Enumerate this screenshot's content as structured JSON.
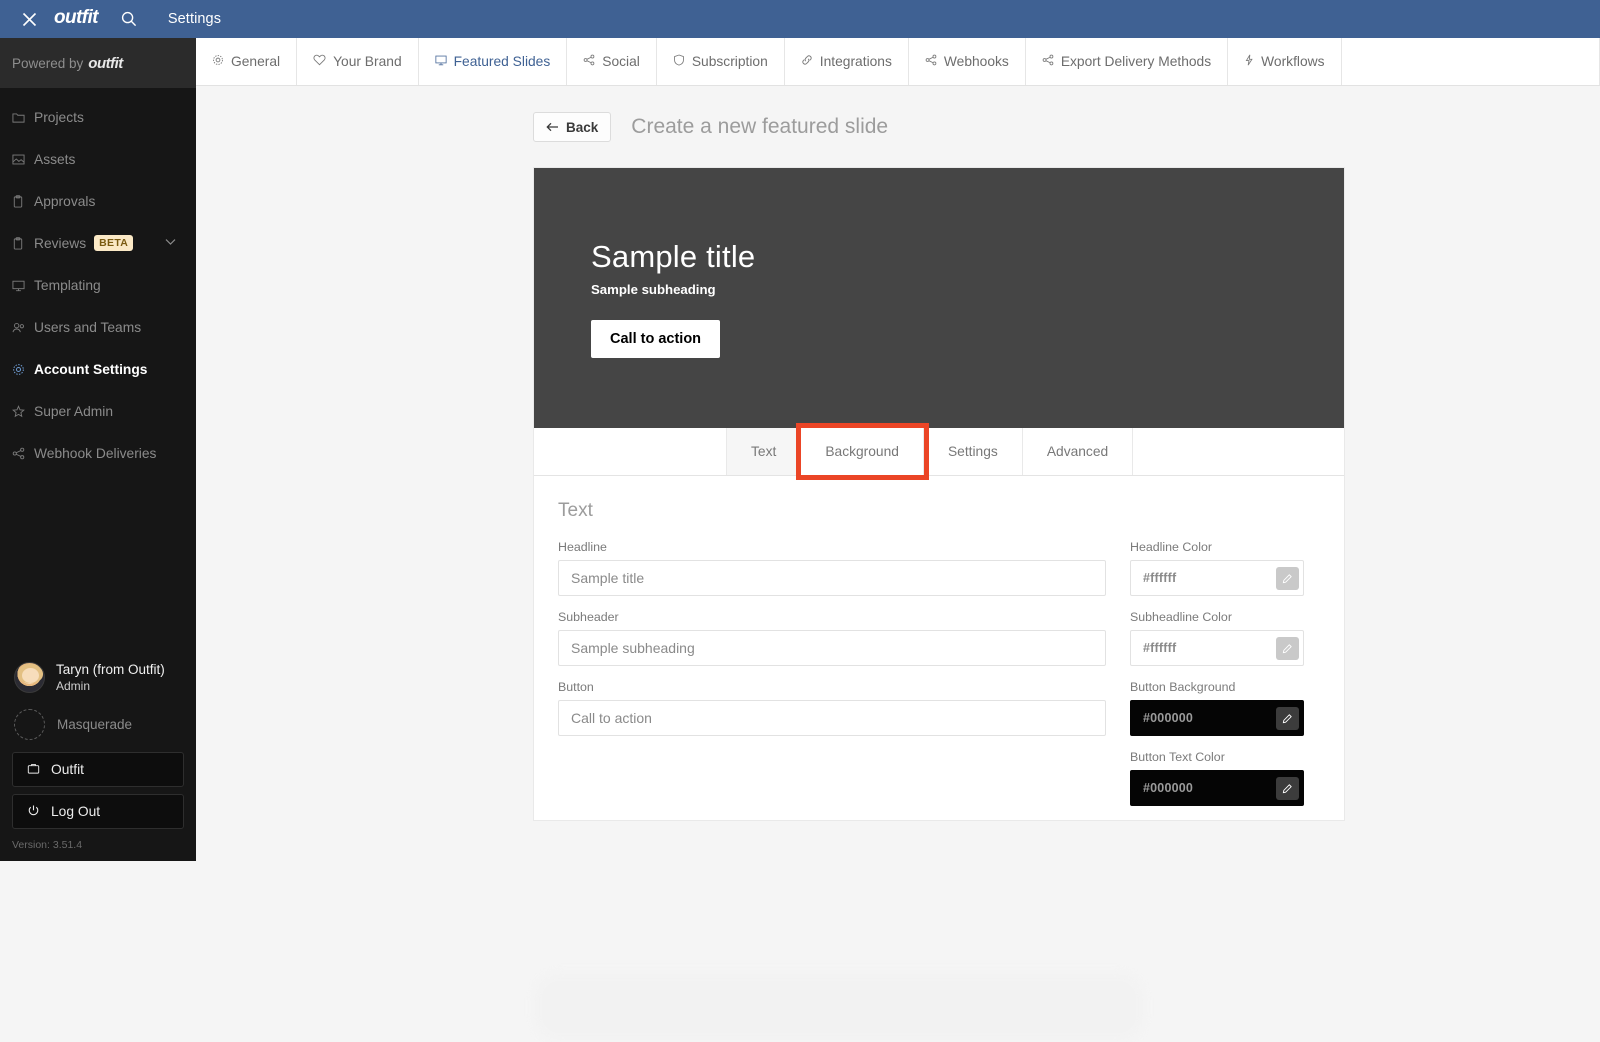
{
  "topbar": {
    "close_icon": "close-icon",
    "logo": "outfit",
    "search_icon": "search-icon",
    "title": "Settings"
  },
  "sidebar": {
    "powered_prefix": "Powered by",
    "powered_brand": "outfit",
    "items": [
      {
        "label": "Projects",
        "icon": "folder-icon",
        "active": false
      },
      {
        "label": "Assets",
        "icon": "image-icon",
        "active": false
      },
      {
        "label": "Approvals",
        "icon": "clipboard-icon",
        "active": false
      },
      {
        "label": "Reviews",
        "icon": "clipboard-icon",
        "active": false,
        "badge": "BETA",
        "chevron": "chevron-down-icon"
      },
      {
        "label": "Templating",
        "icon": "monitor-icon",
        "active": false
      },
      {
        "label": "Users and Teams",
        "icon": "users-icon",
        "active": false
      },
      {
        "label": "Account Settings",
        "icon": "gear-icon",
        "active": true
      },
      {
        "label": "Super Admin",
        "icon": "star-icon",
        "active": false
      },
      {
        "label": "Webhook Deliveries",
        "icon": "share-icon",
        "active": false
      }
    ],
    "user": {
      "name": "Taryn (from Outfit)",
      "role": "Admin"
    },
    "masquerade_label": "Masquerade",
    "buttons": [
      {
        "label": "Outfit",
        "icon": "briefcase-icon"
      },
      {
        "label": "Log Out",
        "icon": "power-icon"
      }
    ],
    "version": "Version: 3.51.4"
  },
  "tabs": [
    {
      "label": "General",
      "icon": "gear-icon",
      "active": false
    },
    {
      "label": "Your Brand",
      "icon": "heart-icon",
      "active": false
    },
    {
      "label": "Featured Slides",
      "icon": "monitor-icon",
      "active": true
    },
    {
      "label": "Social",
      "icon": "share-icon",
      "active": false
    },
    {
      "label": "Subscription",
      "icon": "shield-icon",
      "active": false
    },
    {
      "label": "Integrations",
      "icon": "link-icon",
      "active": false
    },
    {
      "label": "Webhooks",
      "icon": "share-icon",
      "active": false
    },
    {
      "label": "Export Delivery Methods",
      "icon": "share-icon",
      "active": false
    },
    {
      "label": "Workflows",
      "icon": "bolt-icon",
      "active": false
    }
  ],
  "page": {
    "back_label": "Back",
    "back_icon": "arrow-left-icon",
    "title": "Create a new featured slide"
  },
  "preview": {
    "headline": "Sample title",
    "subheading": "Sample subheading",
    "cta": "Call to action",
    "background_color": "#454545"
  },
  "inner_tabs": [
    {
      "label": "Text",
      "state": "selected"
    },
    {
      "label": "Background",
      "state": "highlight"
    },
    {
      "label": "Settings",
      "state": "normal"
    },
    {
      "label": "Advanced",
      "state": "normal"
    }
  ],
  "highlight_color": "#eb4526",
  "form": {
    "section_title": "Text",
    "left_fields": [
      {
        "label": "Headline",
        "value": "Sample title",
        "placeholder": "Sample title"
      },
      {
        "label": "Subheader",
        "value": "Sample subheading",
        "placeholder": "Sample subheading"
      },
      {
        "label": "Button",
        "value": "Call to action",
        "placeholder": "Call to action"
      }
    ],
    "right_fields": [
      {
        "label": "Headline Color",
        "value": "#ffffff",
        "dark": false,
        "icon": "pencil-icon"
      },
      {
        "label": "Subheadline Color",
        "value": "#ffffff",
        "dark": false,
        "icon": "pencil-icon"
      },
      {
        "label": "Button Background",
        "value": "#000000",
        "dark": true,
        "icon": "pencil-icon"
      },
      {
        "label": "Button Text Color",
        "value": "#000000",
        "dark": true,
        "icon": "pencil-icon"
      }
    ]
  }
}
